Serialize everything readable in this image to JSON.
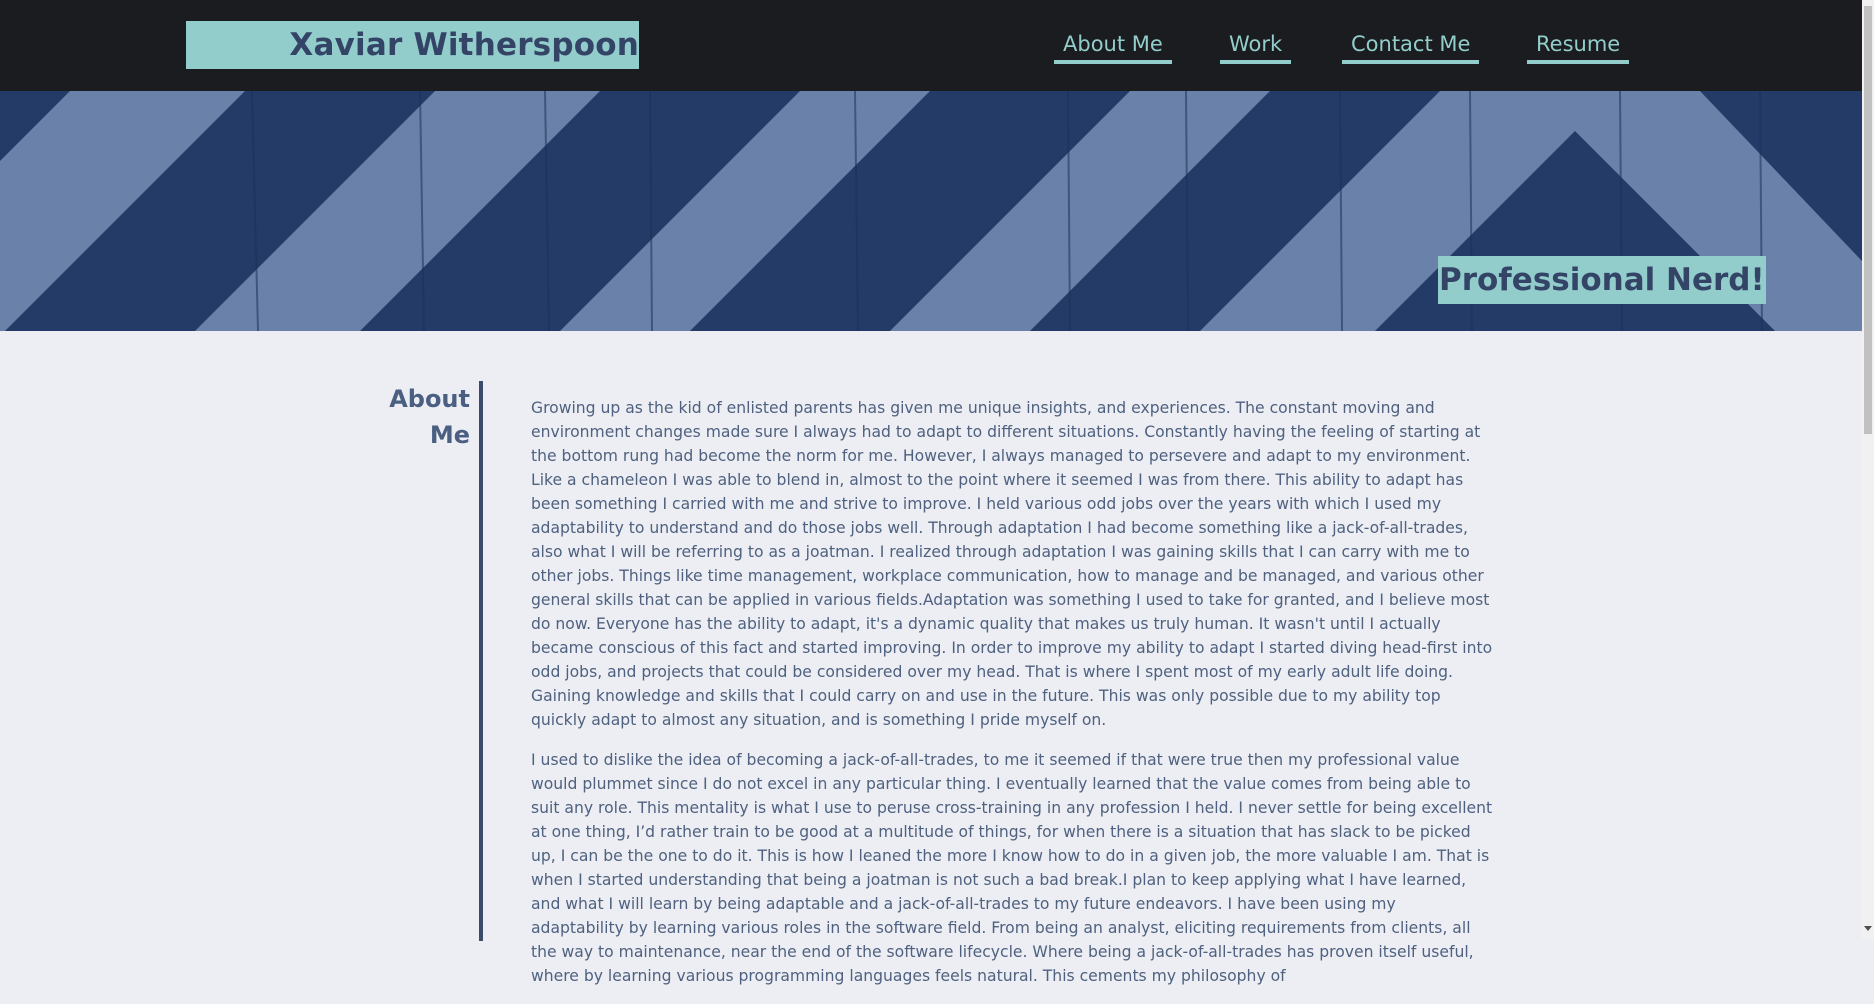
{
  "header": {
    "brand": "Xaviar Witherspoon",
    "nav": [
      {
        "label": "About Me"
      },
      {
        "label": "Work"
      },
      {
        "label": "Contact Me"
      },
      {
        "label": "Resume"
      }
    ]
  },
  "hero": {
    "tagline": "Professional Nerd!"
  },
  "about": {
    "heading_line1": "About",
    "heading_line2": "Me",
    "paragraphs": [
      "Growing up as the kid of enlisted parents has given me unique insights, and experiences. The constant moving and environment changes made sure I always had to adapt to different situations. Constantly having the feeling of starting at the bottom rung had become the norm for me. However, I always managed to persevere and adapt to my environment. Like a chameleon I was able to blend in, almost to the point where it seemed I was from there. This ability to adapt has been something I carried with me and strive to improve. I held various odd jobs over the years with which I used my adaptability to understand and do those jobs well. Through adaptation I had become something like a jack-of-all-trades, also what I will be referring to as a joatman. I realized through adaptation I was gaining skills that I can carry with me to other jobs. Things like time management, workplace communication, how to manage and be managed, and various other general skills that can be applied in various fields.Adaptation was something I used to take for granted, and I believe most do now. Everyone has the ability to adapt, it's a dynamic quality that makes us truly human. It wasn't until I actually became conscious of this fact and started improving. In order to improve my ability to adapt I started diving head-first into odd jobs, and projects that could be considered over my head. That is where I spent most of my early adult life doing. Gaining knowledge and skills that I could carry on and use in the future. This was only possible due to my ability top quickly adapt to almost any situation, and is something I pride myself on.",
      "I used to dislike the idea of becoming a jack-of-all-trades, to me it seemed if that were true then my professional value would plummet since I do not excel in any particular thing. I eventually learned that the value comes from being able to suit any role. This mentality is what I use to peruse cross-training in any profession I held. I never settle for being excellent at one thing, I’d rather train to be good at a multitude of things, for when there is a situation that has slack to be picked up, I can be the one to do it. This is how I leaned the more I know how to do in a given job, the more valuable I am. That is when I started understanding that being a joatman is not such a bad break.I plan to keep applying what I have learned, and what I will learn by being adaptable and a jack-of-all-trades to my future endeavors. I have been using my adaptability by learning various roles in the software field. From being an analyst, eliciting requirements from clients, all the way to maintenance, near the end of the software lifecycle. Where being a jack-of-all-trades has proven itself useful, where by learning various programming languages feels natural. This cements my philosophy of"
    ]
  },
  "colors": {
    "nav_bg": "#1b1c1f",
    "accent": "#92cdcc",
    "brand_text": "#334466",
    "hero_light": "#6a82a9",
    "hero_dark": "#233b66",
    "page_bg": "#eceef4",
    "body_text": "#4f617f"
  }
}
